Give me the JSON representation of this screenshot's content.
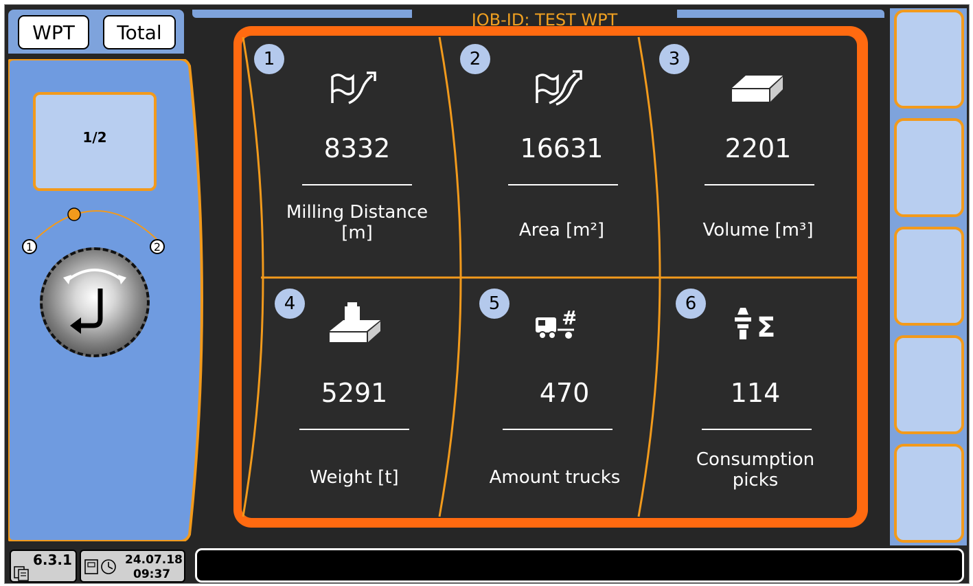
{
  "header": {
    "tabs": [
      "WPT",
      "Total"
    ],
    "job_id": "JOB-ID: TEST WPT"
  },
  "left_panel": {
    "page_indicator": "1/2",
    "knob_positions": [
      "1",
      "2"
    ]
  },
  "tiles": [
    {
      "number": "1",
      "icon": "milling-distance-icon",
      "value": "8332",
      "label_lines": [
        "Milling Distance",
        "[m]"
      ]
    },
    {
      "number": "2",
      "icon": "area-icon",
      "value": "16631",
      "label_lines": [
        "Area [m²]"
      ]
    },
    {
      "number": "3",
      "icon": "volume-icon",
      "value": "2201",
      "label_lines": [
        "Volume [m³]"
      ]
    },
    {
      "number": "4",
      "icon": "weight-icon",
      "value": "5291",
      "label_lines": [
        "Weight [t]"
      ]
    },
    {
      "number": "5",
      "icon": "truck-count-icon",
      "value": "470",
      "label_lines": [
        "Amount trucks"
      ]
    },
    {
      "number": "6",
      "icon": "picks-sum-icon",
      "value": "114",
      "label_lines": [
        "Consumption",
        "picks"
      ]
    }
  ],
  "status_bar": {
    "version": "6.3.1",
    "date": "24.07.18",
    "time": "09:37",
    "message": ""
  },
  "colors": {
    "accent_orange": "#ff6a10",
    "panel_blue": "#7ea3dc",
    "light_blue": "#b8cef0",
    "job_id_text": "#f0a020",
    "background_dark": "#262626"
  }
}
